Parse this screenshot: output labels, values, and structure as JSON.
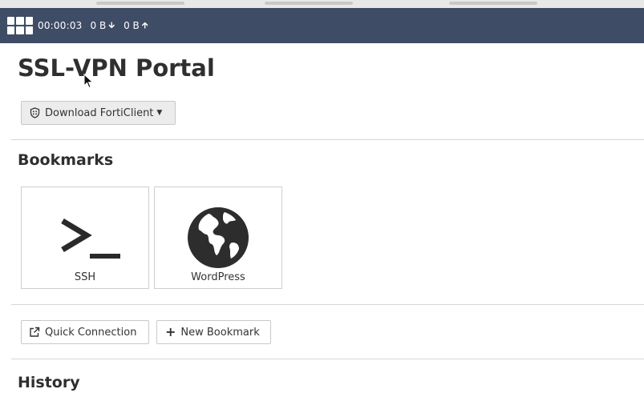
{
  "status_bar": {
    "timer": "00:00:03",
    "bytes_down": "0 B",
    "bytes_up": "0 B",
    "down_icon": "arrow-down-icon",
    "up_icon": "arrow-up-icon",
    "background": "#3f4c66"
  },
  "page": {
    "title": "SSL-VPN Portal",
    "download_button": "Download FortiClient"
  },
  "bookmarks": {
    "heading": "Bookmarks",
    "items": [
      {
        "label": "SSH",
        "icon": "terminal-icon"
      },
      {
        "label": "WordPress",
        "icon": "globe-icon"
      }
    ]
  },
  "actions": {
    "quick_connection": "Quick Connection",
    "new_bookmark": "New Bookmark"
  },
  "history": {
    "heading": "History"
  }
}
